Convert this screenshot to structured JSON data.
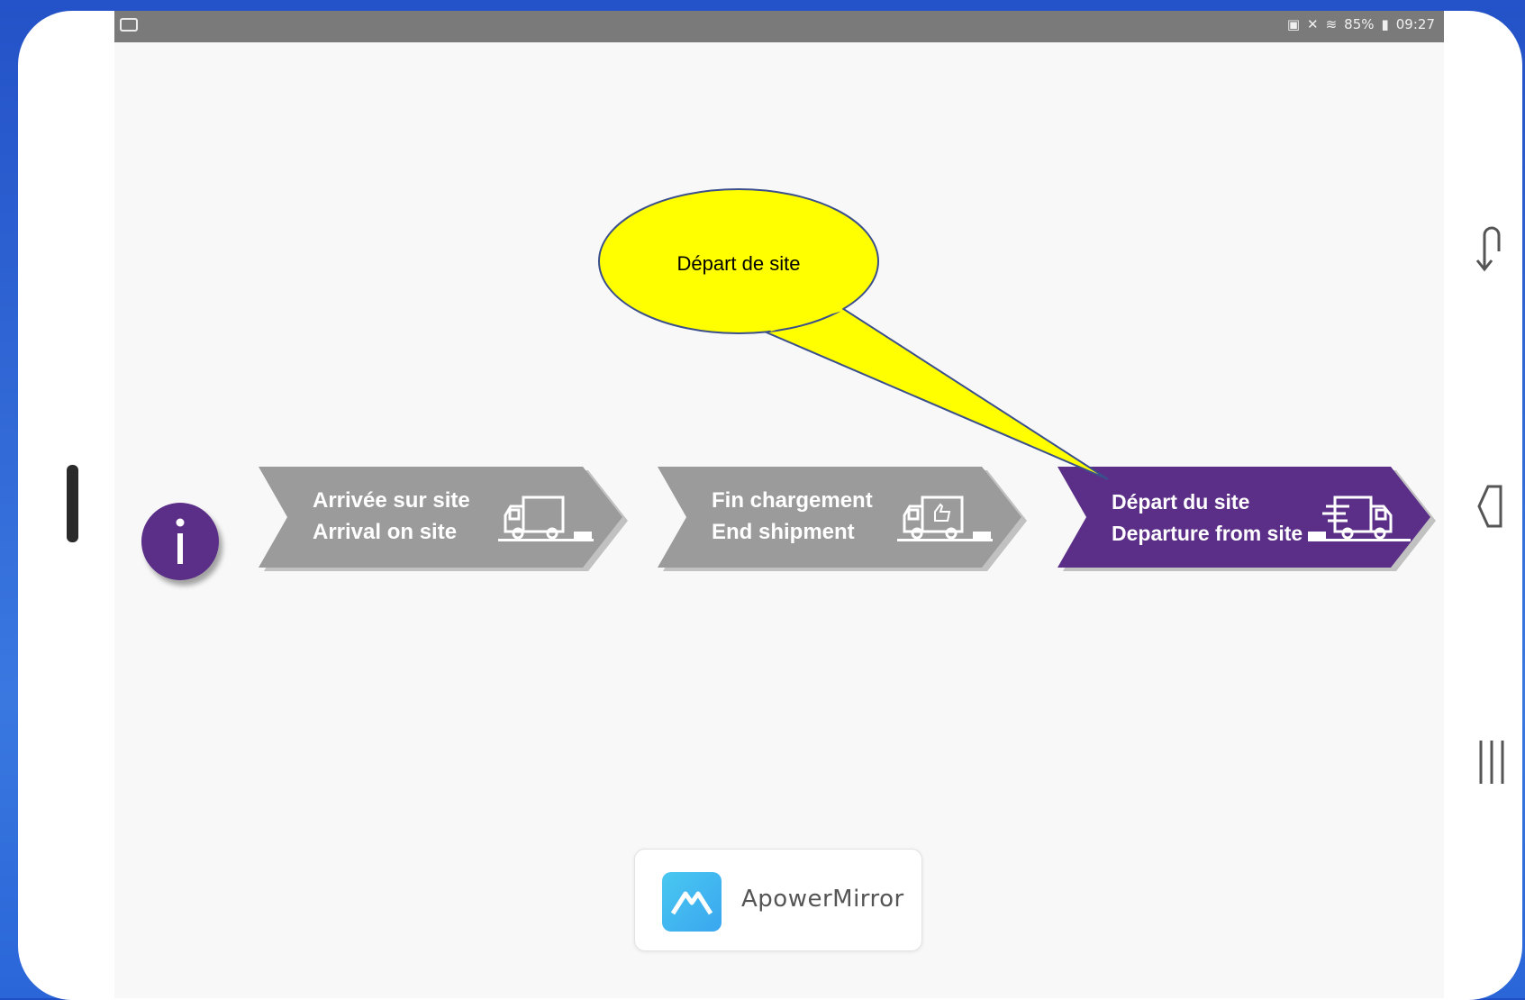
{
  "status_bar": {
    "battery": "85%",
    "time": "09:27",
    "icons": [
      "screen-mirror-icon",
      "mute-icon",
      "wifi-icon",
      "battery-icon"
    ]
  },
  "info_button": {
    "icon": "info-icon",
    "color": "#5b2f88"
  },
  "workflow": {
    "steps": [
      {
        "line1": "Arrivée sur site",
        "line2": "Arrival on site",
        "icon": "truck-icon",
        "color": "#9b9b9b",
        "active": false
      },
      {
        "line1": "Fin chargement",
        "line2": "End shipment",
        "icon": "truck-thumbs-up-icon",
        "color": "#9b9b9b",
        "active": false
      },
      {
        "line1": "Départ du site",
        "line2": "Departure from site",
        "icon": "truck-departing-icon",
        "color": "#5b2f88",
        "active": true
      }
    ]
  },
  "callout": {
    "text": "Départ de site",
    "fill": "#ffff00"
  },
  "apowermirror": {
    "name": "ApowerMirror",
    "icon": "apowermirror-logo-icon"
  },
  "nav_bar": {
    "buttons": [
      "rotate-icon",
      "back-icon",
      "recent-apps-icon"
    ]
  }
}
